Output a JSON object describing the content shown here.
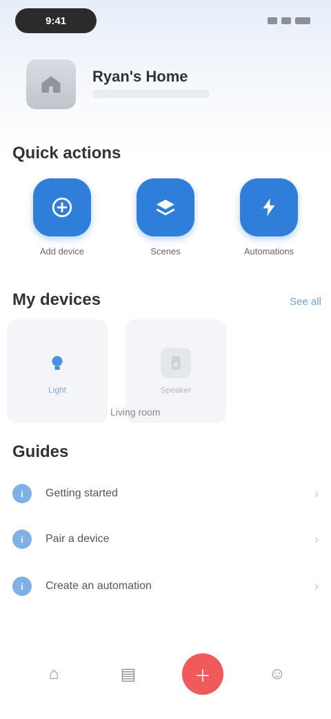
{
  "status": {
    "time": "9:41"
  },
  "profile": {
    "name": "Ryan's Home"
  },
  "quick_actions": {
    "title": "Quick actions",
    "items": [
      {
        "label": "Add device",
        "icon": "plus-icon"
      },
      {
        "label": "Scenes",
        "icon": "layers-icon"
      },
      {
        "label": "Automations",
        "icon": "flash-icon"
      }
    ]
  },
  "devices": {
    "title": "My devices",
    "see_all": "See all",
    "cards": [
      {
        "label": "Light",
        "icon": "bulb-icon",
        "active": true
      },
      {
        "label": "Speaker",
        "icon": "speaker-icon",
        "active": false
      }
    ],
    "caption": "Living room"
  },
  "guides": {
    "title": "Guides",
    "items": [
      {
        "label": "Getting started"
      },
      {
        "label": "Pair a device"
      },
      {
        "label": "Create an automation"
      }
    ]
  },
  "nav": {
    "items": [
      {
        "name": "home",
        "glyph": "⌂"
      },
      {
        "name": "devices",
        "glyph": "▤"
      },
      {
        "name": "add",
        "glyph": "＋",
        "active": true
      },
      {
        "name": "profile",
        "glyph": "☺"
      }
    ]
  },
  "colors": {
    "primary": "#2f7fd9",
    "accent": "#f05a5a",
    "link": "#6aa3e6"
  }
}
